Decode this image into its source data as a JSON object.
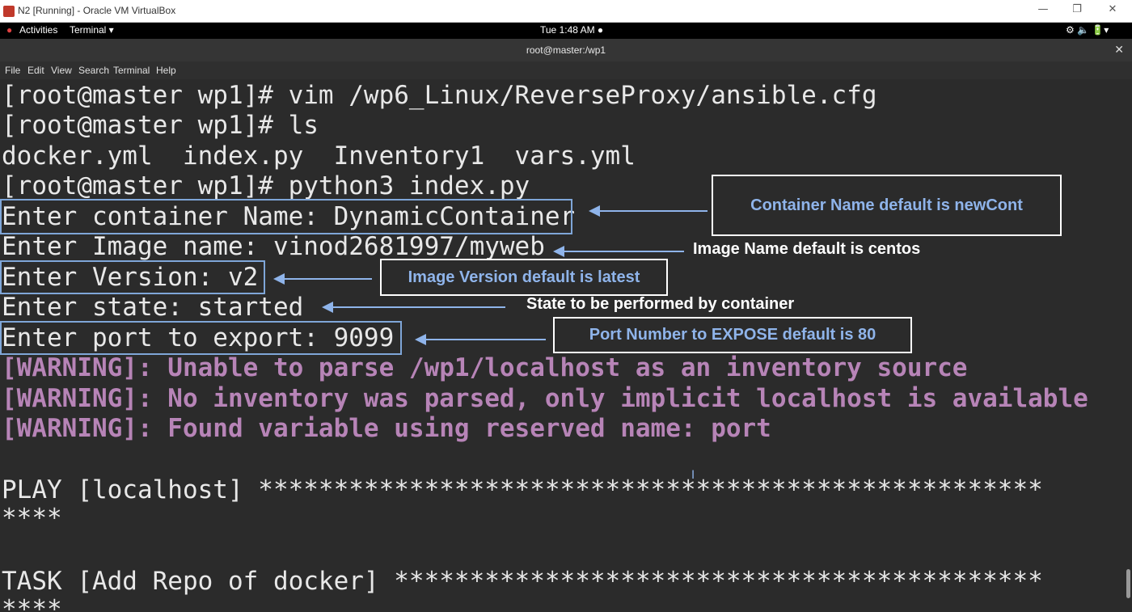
{
  "window": {
    "title": "N2 [Running] - Oracle VM VirtualBox"
  },
  "topbar": {
    "activities": "Activities",
    "app_menu": "Terminal ▾",
    "clock": "Tue  1:48 AM ●",
    "status_icons": "⚙  🔈  🔋▾"
  },
  "terminal": {
    "title": "root@master:/wp1",
    "menu": [
      "File",
      "Edit",
      "View",
      "Search",
      "Terminal",
      "Help"
    ],
    "lines": [
      "[root@master wp1]# vim /wp6_Linux/ReverseProxy/ansible.cfg",
      "[root@master wp1]# ls",
      "docker.yml  index.py  Inventory1  vars.yml",
      "[root@master wp1]# python3 index.py",
      "Enter container Name: DynamicContainer",
      "Enter Image name: vinod2681997/myweb",
      "Enter Version: v2",
      "Enter state: started",
      "Enter port to export: 9099",
      "[WARNING]: Unable to parse /wp1/localhost as an inventory source",
      "[WARNING]: No inventory was parsed, only implicit localhost is available",
      "[WARNING]: Found variable using reserved name: port",
      "",
      "PLAY [localhost] ****************************************************",
      "****",
      "",
      "",
      "TASK [Add Repo of docker] *******************************************",
      "****"
    ]
  },
  "annotations": {
    "container_name": "Container Name default is newCont",
    "image_name": "Image Name default is centos",
    "image_version": "Image Version default is latest",
    "state": "State to be performed by container",
    "port": "Port Number to EXPOSE default is 80"
  }
}
